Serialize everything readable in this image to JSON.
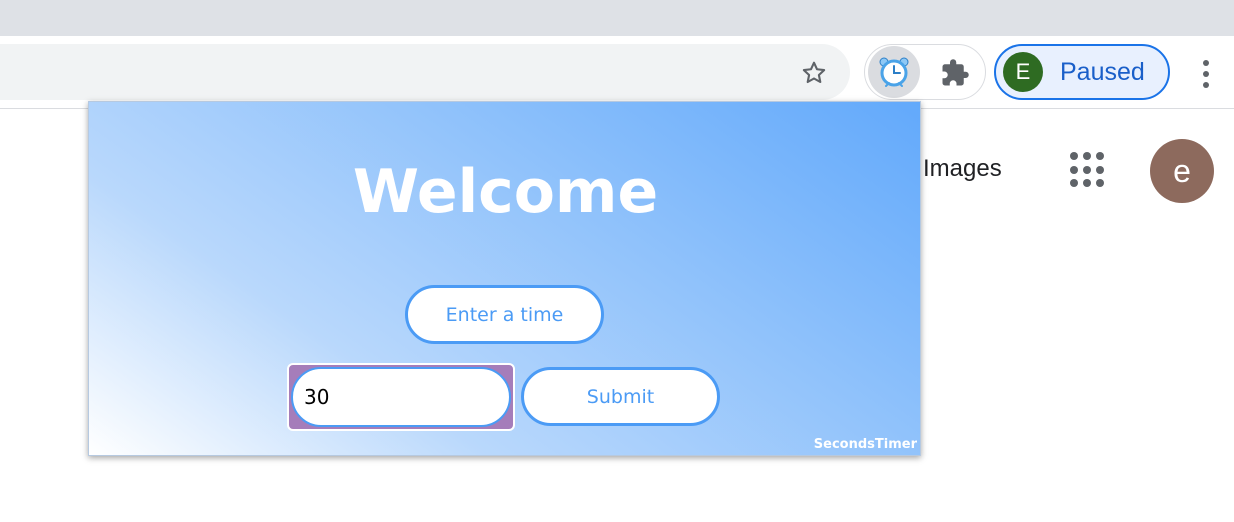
{
  "toolbar": {
    "bookmark_icon": "star-outline-icon",
    "extensions": [
      {
        "name": "alarm-clock-icon",
        "active": true
      },
      {
        "name": "puzzle-icon",
        "active": false
      }
    ],
    "profile": {
      "initial": "E",
      "status": "Paused",
      "avatar_color": "#2e6b22"
    },
    "menu_icon": "kebab-menu-icon"
  },
  "page": {
    "images_link": "Images",
    "apps_icon": "apps-grid-icon",
    "account_initial": "e",
    "account_color": "#8d6a5d"
  },
  "popup": {
    "title": "Welcome",
    "prompt_label": "Enter a time",
    "time_input_value": "30",
    "submit_label": "Submit",
    "brand": "SecondsTimer",
    "accent_color": "#4b9bf5"
  }
}
